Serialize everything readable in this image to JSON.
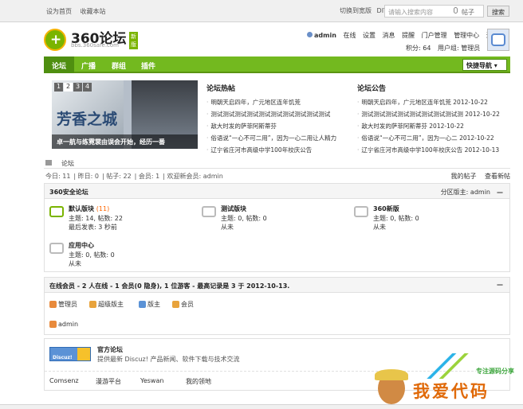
{
  "topbar": {
    "links": [
      "设为首页",
      "收藏本站"
    ],
    "right_links": [
      "切换到宽版",
      "DIY"
    ],
    "search_placeholder": "请输入搜索内容",
    "search_type": "帖子",
    "search_button": "搜索"
  },
  "header": {
    "brand": "360论坛",
    "brand_badge": "新版",
    "url": "bbs.360safe.com",
    "user_links": [
      "admin",
      "在线",
      "设置",
      "消息",
      "提醒",
      "门户管理",
      "管理中心",
      "退出"
    ],
    "credits": "积分: 64",
    "usergroup": "用户组: 管理员"
  },
  "nav": {
    "items": [
      "论坛",
      "广播",
      "群组",
      "插件"
    ],
    "quick_nav": "快捷导航"
  },
  "slider": {
    "pages": [
      "1",
      "2",
      "3",
      "4"
    ],
    "active_page": "2",
    "title": "芳香之城",
    "caption": "卓一航与练霓裳由误会开始，经历一番"
  },
  "hot": {
    "title": "论坛热帖",
    "items": [
      "明朝天启四年，广元地区连年饥荒",
      "测试测试测试测试测试测试测试测试测试测试",
      "敌大时发的萨菲阿斯蒂芬",
      "俗语说“一心不可二用”，因为一心二用让人精力",
      "辽宁省庄河市高级中学100年校庆公告"
    ]
  },
  "notice": {
    "title": "论坛公告",
    "items": [
      {
        "text": "明朝天启四年，广元地区连年饥荒",
        "date": "2012-10-22"
      },
      {
        "text": "测试测试测试测试测试测试测试测试测",
        "date": "2012-10-22"
      },
      {
        "text": "敌大时发的萨菲阿斯蒂芬",
        "date": "2012-10-22"
      },
      {
        "text": "俗语说“一心不可二用”，因为一心二",
        "date": "2012-10-22"
      },
      {
        "text": "辽宁省庄河市高级中学100年校庆公告",
        "date": "2012-10-13"
      }
    ]
  },
  "breadcrumb": "论坛",
  "stats": {
    "items": [
      "今日: 11",
      "昨日: 0",
      "帖子: 22",
      "会员: 1",
      "欢迎新会员: admin"
    ],
    "right": [
      "我的帖子",
      "查看新帖"
    ]
  },
  "category": {
    "title": "360安全论坛",
    "moderator": "分区版主: admin",
    "collapse": "—",
    "forums": [
      {
        "name": "默认版块",
        "count": "(11)",
        "lines": [
          "主题: 14, 帖数: 22",
          "最后发表: 3 秒前"
        ]
      },
      {
        "name": "测试版块",
        "count": "",
        "lines": [
          "主题: 0, 帖数: 0",
          "从未"
        ]
      },
      {
        "name": "360新版",
        "count": "",
        "lines": [
          "主题: 0, 帖数: 0",
          "从未"
        ]
      },
      {
        "name": "应用中心",
        "count": "",
        "lines": [
          "主题: 0, 帖数: 0",
          "从未"
        ]
      }
    ]
  },
  "online": {
    "title": "在线会员 - 2 人在线 - 1 会员(0 隐身), 1 位游客 - 最高记录是 3 于 2012-10-13.",
    "collapse": "—",
    "legend": [
      "管理员",
      "超级版主",
      "版主",
      "会员"
    ],
    "users": [
      "admin"
    ]
  },
  "links": {
    "badge_text": "Discuz!",
    "title": "官方论坛",
    "desc": "提供最新 Discuz! 产品新闻、软件下载与技术交流",
    "items": [
      "Comsenz",
      "漫游平台",
      "Yeswan",
      "我的领地"
    ]
  },
  "watermark": {
    "tag": "专注源码分享",
    "big": "我爱代码"
  }
}
